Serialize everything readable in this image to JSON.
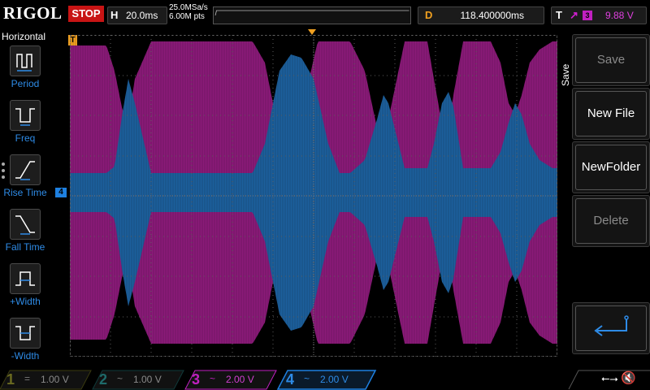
{
  "header": {
    "logo": "RIGOL",
    "run_state": "STOP",
    "horizontal": {
      "key": "H",
      "value": "20.0ms"
    },
    "sample_rate": "25.0MSa/s",
    "memory_depth": "6.00M pts",
    "delay": {
      "key": "D",
      "value": "118.400000ms"
    },
    "trigger": {
      "key": "T",
      "source": "3",
      "level": "9.88 V"
    }
  },
  "left_menu": {
    "title": "Horizontal",
    "items": [
      {
        "label": "Period",
        "icon": "period-icon"
      },
      {
        "label": "Freq",
        "icon": "freq-icon"
      },
      {
        "label": "Rise Time",
        "icon": "rise-time-icon"
      },
      {
        "label": "Fall Time",
        "icon": "fall-time-icon"
      },
      {
        "label": "+Width",
        "icon": "positive-width-icon"
      },
      {
        "label": "-Width",
        "icon": "negative-width-icon"
      }
    ]
  },
  "right_menu": {
    "title": "Save",
    "buttons": [
      {
        "label": "Save",
        "enabled": false
      },
      {
        "label": "New File",
        "enabled": true
      },
      {
        "label": "NewFolder",
        "enabled": true
      },
      {
        "label": "Delete",
        "enabled": false
      }
    ],
    "enter_icon": "enter-return-icon"
  },
  "markers": {
    "trigger_pos": "T",
    "ch4_ref": "4"
  },
  "channels": [
    {
      "num": "1",
      "coupling": "=",
      "scale": "1.00 V",
      "color": "#c8c820",
      "active": false
    },
    {
      "num": "2",
      "coupling": "~",
      "scale": "1.00 V",
      "color": "#20c8c8",
      "active": false
    },
    {
      "num": "3",
      "coupling": "~",
      "scale": "2.00 V",
      "color": "#c020c0",
      "active": true
    },
    {
      "num": "4",
      "coupling": "~",
      "scale": "2.00 V",
      "color": "#1e80e0",
      "active": true,
      "selected": true
    }
  ],
  "colors": {
    "ch3_trace": "#8a1a78",
    "ch4_trace": "#1c5f9c",
    "grid": "#5a5a5a",
    "accent": "#f0a020"
  }
}
